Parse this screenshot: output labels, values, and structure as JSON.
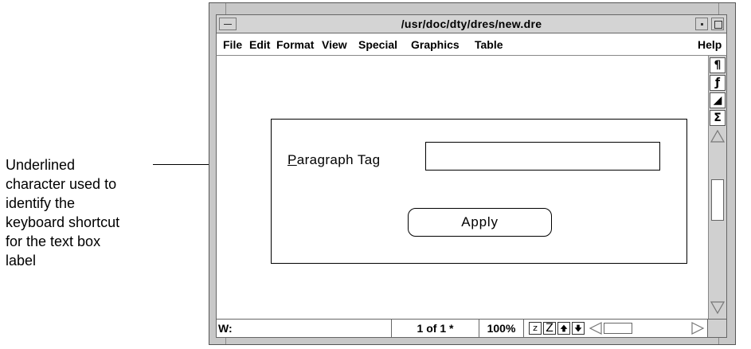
{
  "callout": {
    "lines": [
      "Underlined",
      "character used to",
      "identify the",
      "keyboard shortcut",
      "for the text box",
      "label"
    ]
  },
  "window": {
    "title": "/usr/doc/dty/dres/new.dre"
  },
  "menubar": {
    "items": [
      "File",
      "Edit",
      "Format",
      "View",
      "Special",
      "Graphics",
      "Table"
    ],
    "help": "Help"
  },
  "dialog": {
    "label_mnemonic": "P",
    "label_rest": "aragraph Tag",
    "input_value": "",
    "apply_label": "Apply"
  },
  "toolbar": {
    "buttons": [
      {
        "glyph": "¶",
        "icon": "paragraph-icon"
      },
      {
        "glyph": "ƒ",
        "icon": "function-icon"
      },
      {
        "glyph": "◢",
        "icon": "triangle-icon"
      },
      {
        "glyph": "Σ",
        "icon": "sigma-icon"
      }
    ]
  },
  "statusbar": {
    "w_label": "W:",
    "page": "1 of 1 *",
    "zoom": "100%",
    "z_small": "z",
    "z_large": "Z"
  }
}
